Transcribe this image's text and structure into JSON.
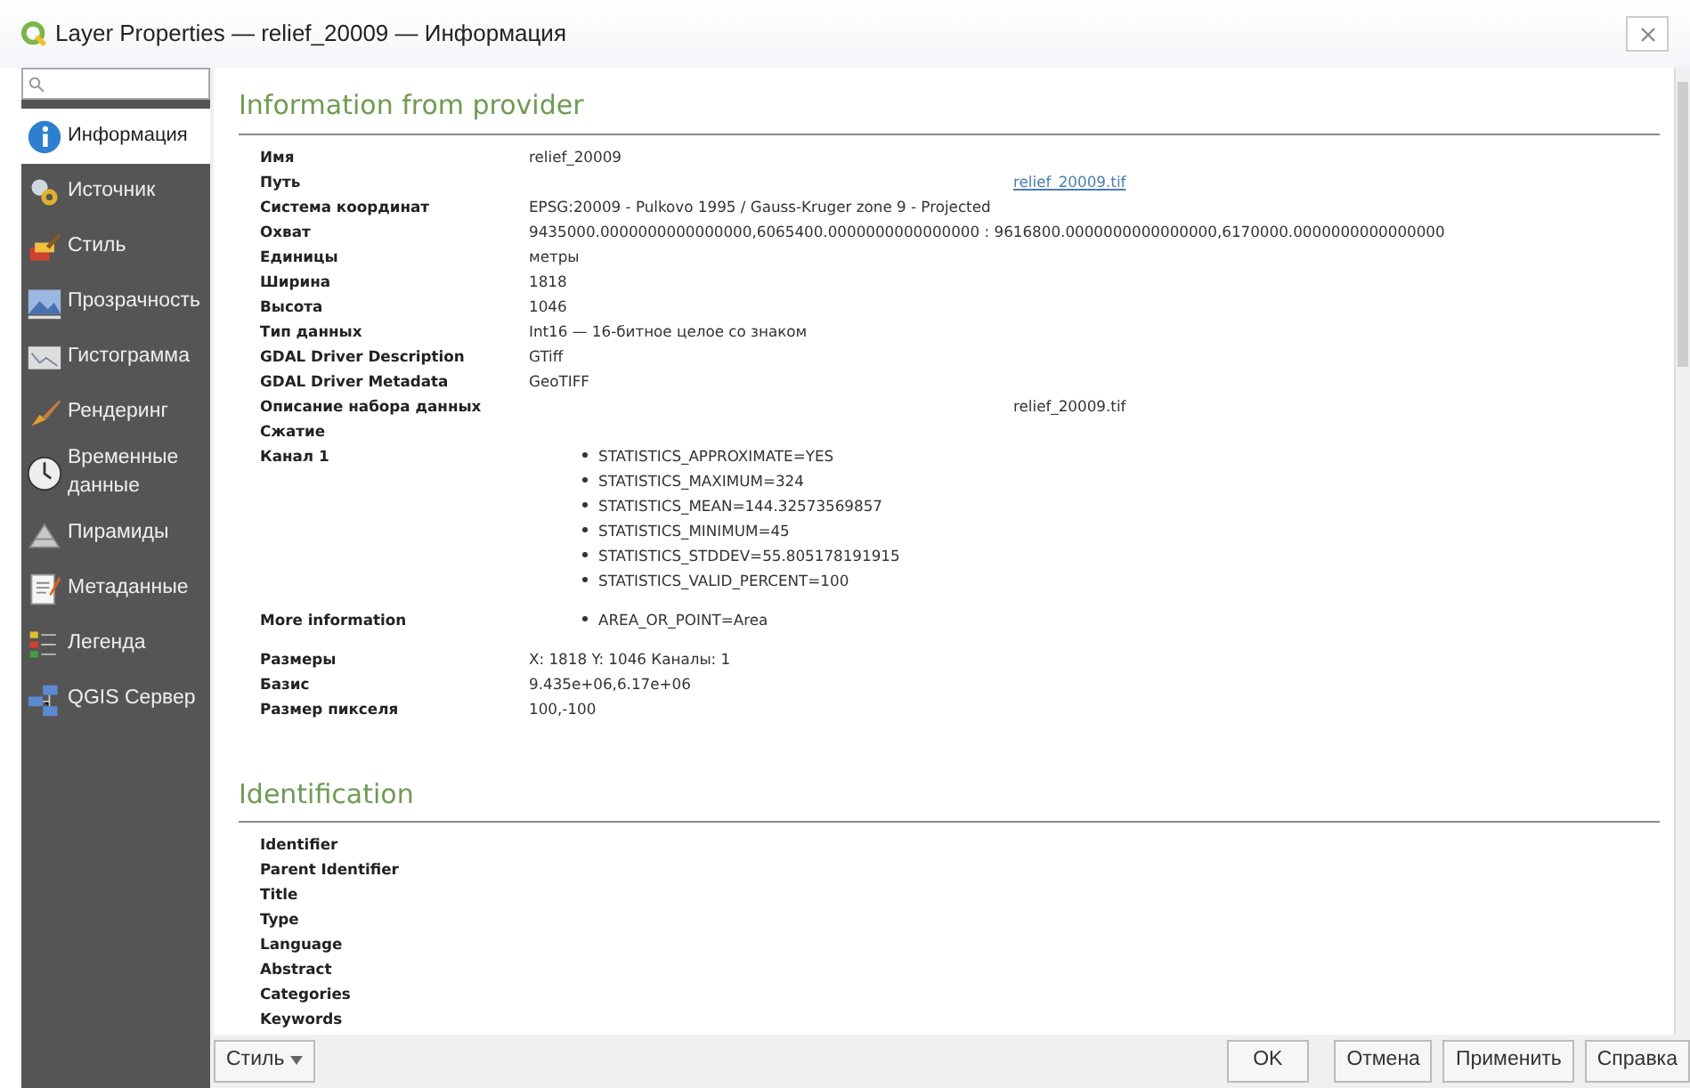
{
  "window": {
    "title": "Layer Properties — relief_20009 — Информация"
  },
  "sidebar": {
    "items": [
      {
        "label": "Информация",
        "selected": true
      },
      {
        "label": "Источник",
        "selected": false
      },
      {
        "label": "Стиль",
        "selected": false
      },
      {
        "label": "Прозрачность",
        "selected": false
      },
      {
        "label": "Гистограмма",
        "selected": false
      },
      {
        "label": "Рендеринг",
        "selected": false
      },
      {
        "label": "Временные данные",
        "selected": false
      },
      {
        "label": "Пирамиды",
        "selected": false
      },
      {
        "label": "Метаданные",
        "selected": false
      },
      {
        "label": "Легенда",
        "selected": false
      },
      {
        "label": "QGIS Сервер",
        "selected": false
      }
    ]
  },
  "sections": [
    {
      "title": "Information from provider",
      "rows": [
        {
          "label": "Имя",
          "kind": "text",
          "value": "relief_20009"
        },
        {
          "label": "Путь",
          "kind": "far_link",
          "value": "relief_20009.tif"
        },
        {
          "label": "Система координат",
          "kind": "text",
          "value": "EPSG:20009 - Pulkovo 1995 / Gauss-Kruger zone 9 - Projected"
        },
        {
          "label": "Охват",
          "kind": "text",
          "value": "9435000.0000000000000000,6065400.0000000000000000 : 9616800.0000000000000000,6170000.0000000000000000"
        },
        {
          "label": "Единицы",
          "kind": "text",
          "value": "метры"
        },
        {
          "label": "Ширина",
          "kind": "text",
          "value": "1818"
        },
        {
          "label": "Высота",
          "kind": "text",
          "value": "1046"
        },
        {
          "label": "Тип данных",
          "kind": "text",
          "value": "Int16 — 16-битное целое со знаком"
        },
        {
          "label": "GDAL Driver Description",
          "kind": "text",
          "value": "GTiff"
        },
        {
          "label": "GDAL Driver Metadata",
          "kind": "text",
          "value": "GeoTIFF"
        },
        {
          "label": "Описание набора данных",
          "kind": "far_text",
          "value": "relief_20009.tif"
        },
        {
          "label": "Сжатие",
          "kind": "text"
        },
        {
          "label": "Канал 1",
          "kind": "list",
          "items": [
            "STATISTICS_APPROXIMATE=YES",
            "STATISTICS_MAXIMUM=324",
            "STATISTICS_MEAN=144.32573569857",
            "STATISTICS_MINIMUM=45",
            "STATISTICS_STDDEV=55.805178191915",
            "STATISTICS_VALID_PERCENT=100"
          ]
        },
        {
          "label": "More information",
          "kind": "list",
          "items": [
            "AREA_OR_POINT=Area"
          ]
        },
        {
          "label": "Размеры",
          "kind": "text",
          "value": "X: 1818 Y: 1046 Каналы: 1"
        },
        {
          "label": "Базис",
          "kind": "text",
          "value": "9.435e+06,6.17e+06"
        },
        {
          "label": "Размер пикселя",
          "kind": "text",
          "value": "100,-100"
        }
      ]
    },
    {
      "title": "Identification",
      "rows": [
        {
          "label": "Identifier",
          "kind": "text"
        },
        {
          "label": "Parent Identifier",
          "kind": "text"
        },
        {
          "label": "Title",
          "kind": "text"
        },
        {
          "label": "Type",
          "kind": "text"
        },
        {
          "label": "Language",
          "kind": "text"
        },
        {
          "label": "Abstract",
          "kind": "text"
        },
        {
          "label": "Categories",
          "kind": "text"
        },
        {
          "label": "Keywords",
          "kind": "text"
        }
      ]
    }
  ],
  "footer": {
    "style_menu": "Стиль",
    "buttons": [
      "OK",
      "Отмена",
      "Применить",
      "Справка"
    ]
  }
}
